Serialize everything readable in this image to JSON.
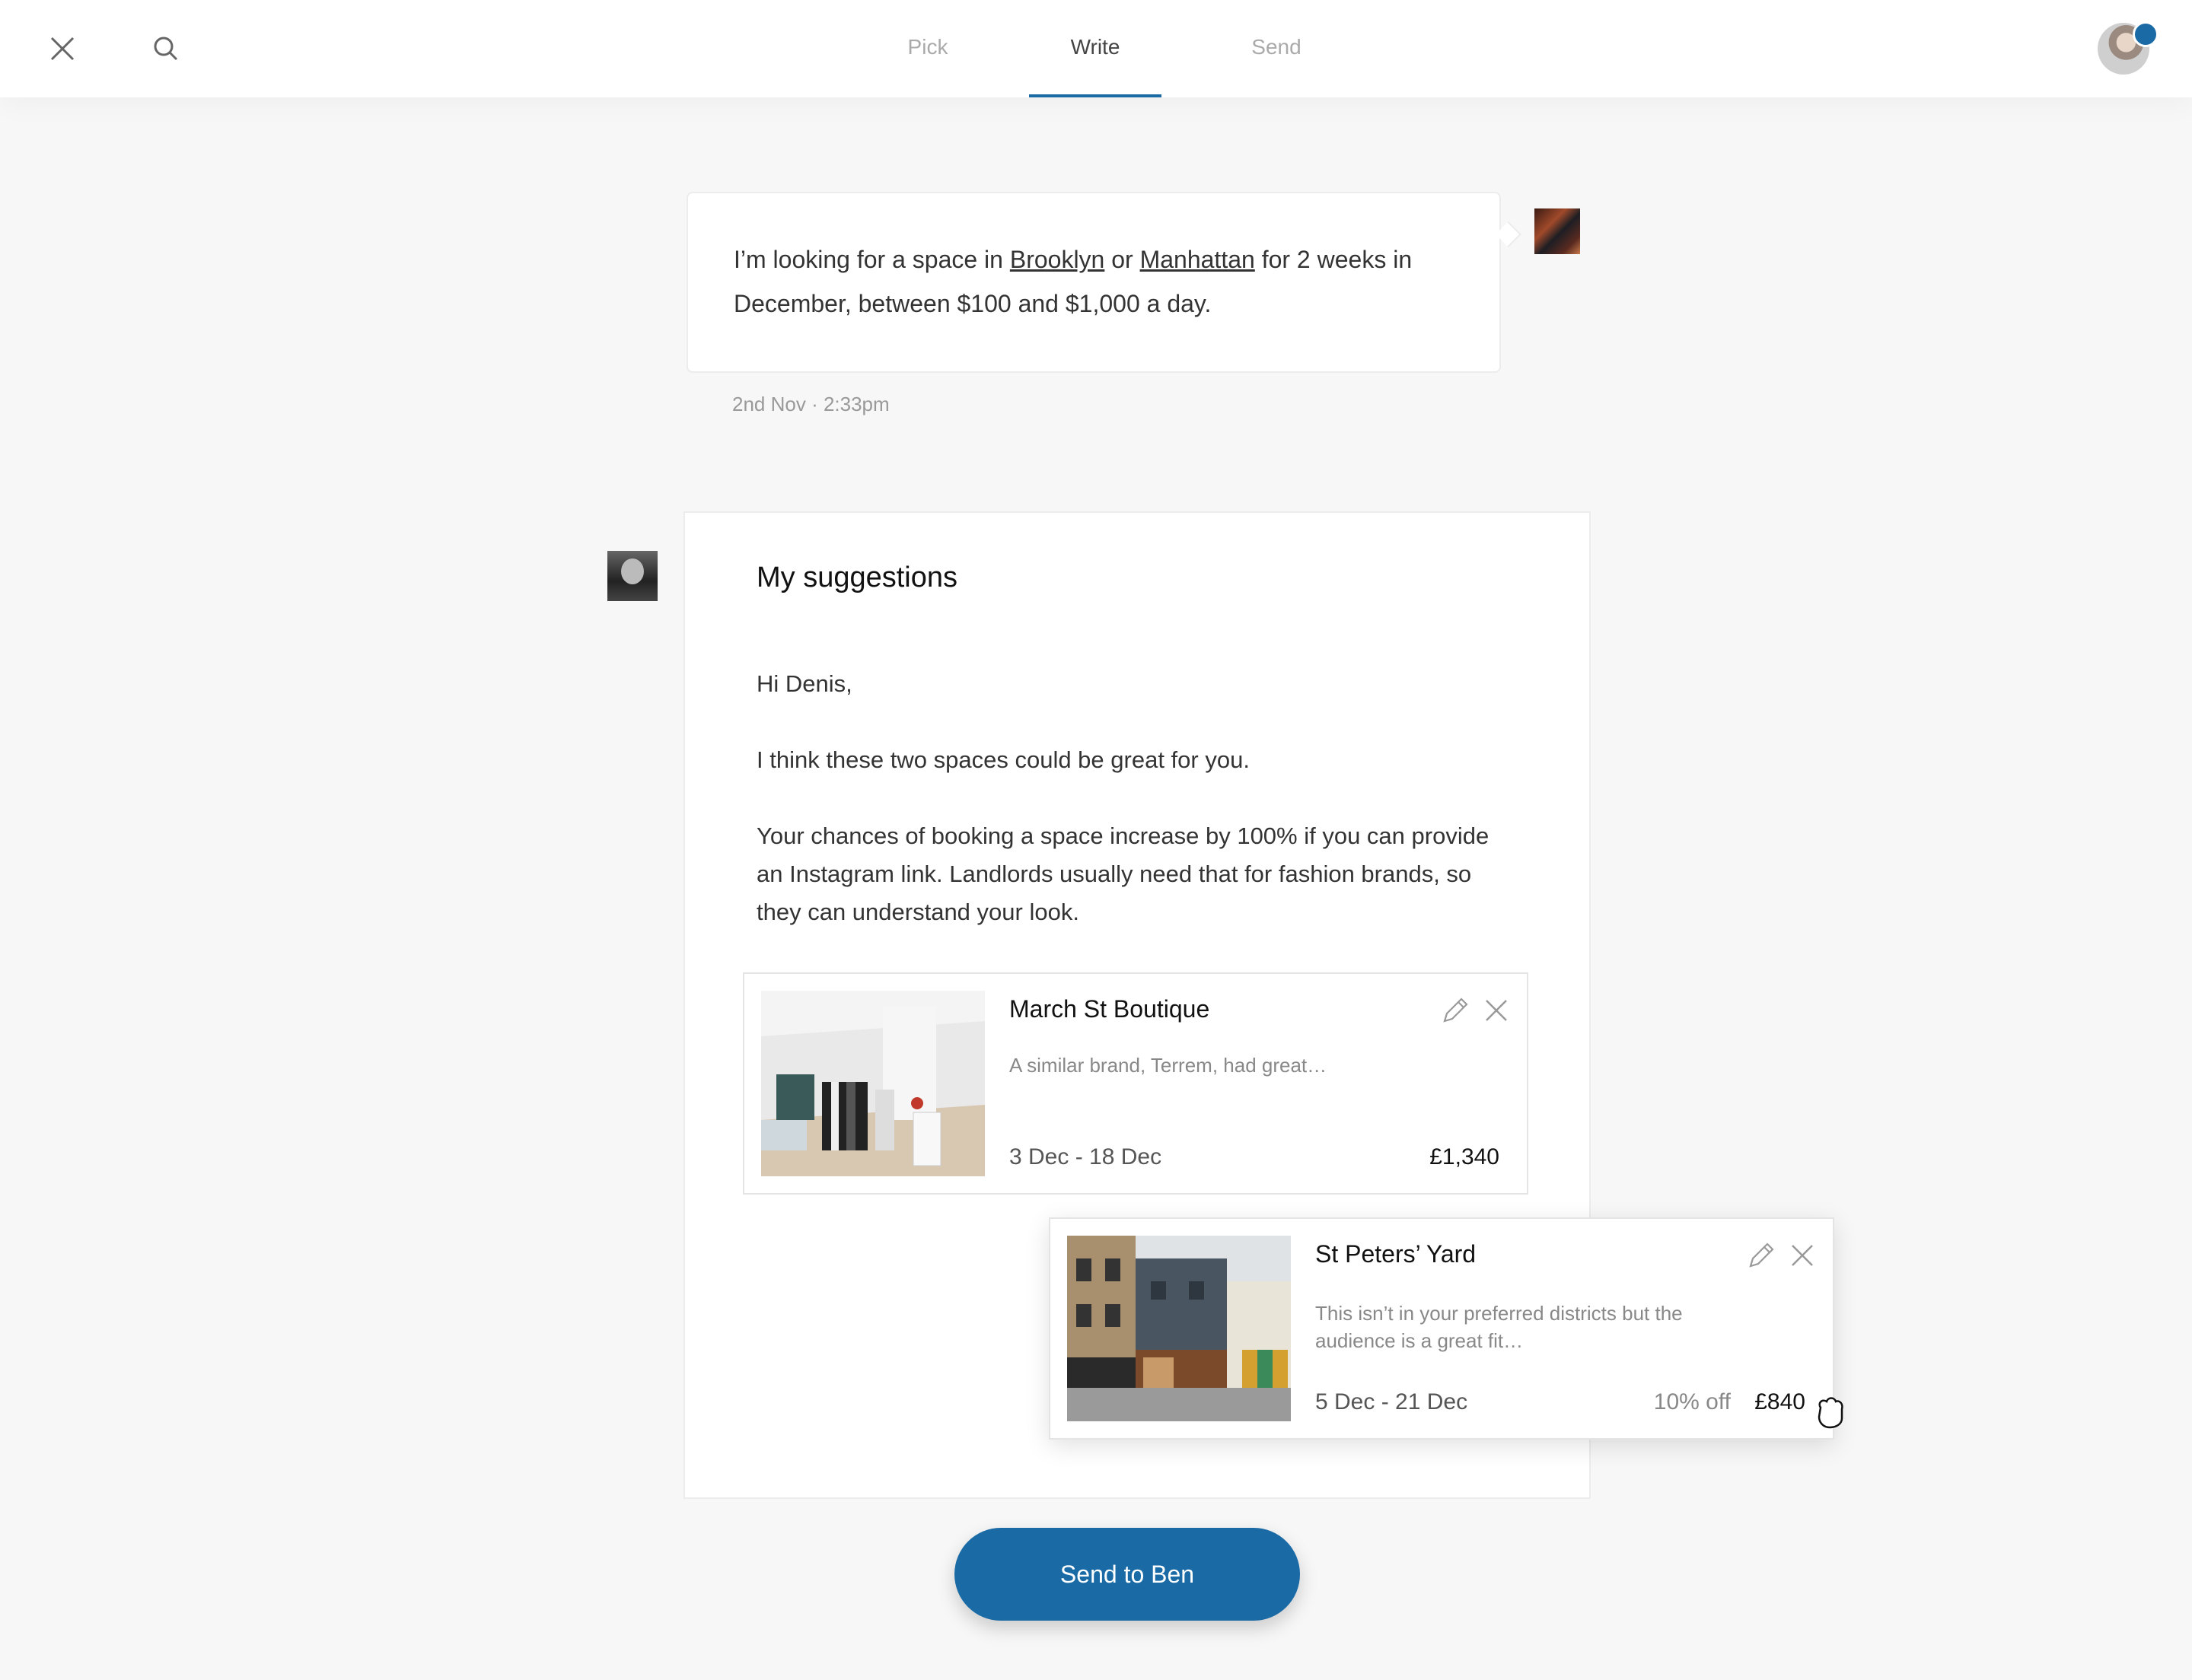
{
  "header": {
    "tabs": [
      {
        "label": "Pick",
        "active": false
      },
      {
        "label": "Write",
        "active": true
      },
      {
        "label": "Send",
        "active": false
      }
    ],
    "close_icon": "close-icon",
    "search_icon": "search-icon",
    "accent_color": "#1a6aa6"
  },
  "request": {
    "text_before": "I’m looking for a space in ",
    "link1": "Brooklyn",
    "text_mid": " or ",
    "link2": "Manhattan",
    "text_after": " for 2 weeks in December, between $100 and $1,000 a day.",
    "timestamp": "2nd Nov · 2:33pm"
  },
  "suggestions": {
    "title": "My suggestions",
    "greeting": "Hi Denis,",
    "intro": "I think these two spaces could be great for you.",
    "note": "Your chances of booking a space increase by 100% if you can provide an Instagram link.  Landlords usually need that for fashion brands, so they can understand your look.",
    "cards": [
      {
        "name": "March St Boutique",
        "description": "A similar brand, Terrem, had great…",
        "dates": "3 Dec - 18 Dec",
        "price": "£1,340",
        "discount": ""
      },
      {
        "name": "St Peters’ Yard",
        "description": "This isn’t in your preferred districts but the audience is a great fit…",
        "dates": "5 Dec - 21 Dec",
        "discount": "10% off",
        "price": "£840"
      }
    ]
  },
  "footer": {
    "send_label": "Send to Ben"
  }
}
